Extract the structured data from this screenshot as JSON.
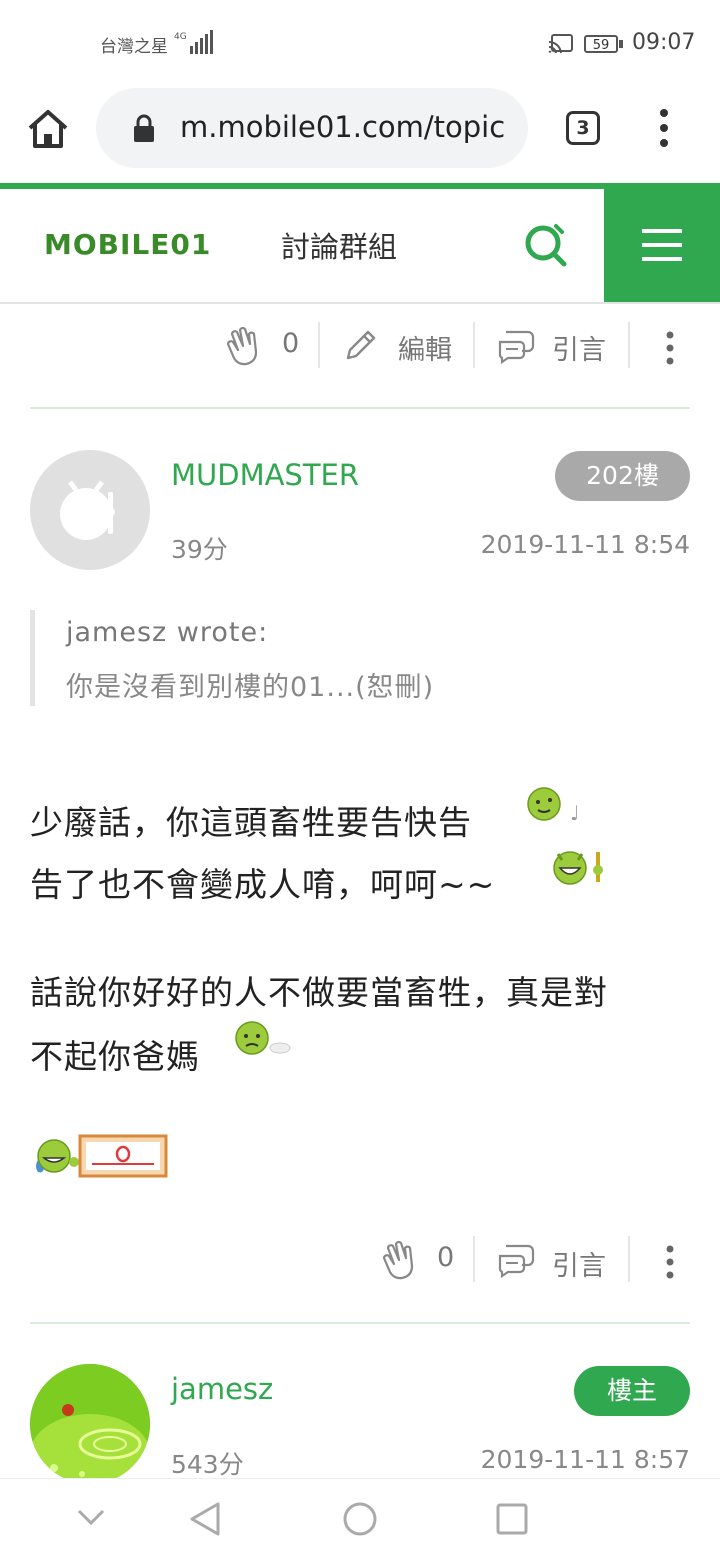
{
  "status_bar": {
    "carrier": "台灣之星",
    "network": "4G",
    "battery": "59",
    "time": "09:07"
  },
  "browser": {
    "url": "m.mobile01.com/topic",
    "tab_count": "3"
  },
  "site": {
    "logo_text": "MOBILE01",
    "section_title": "討論群組"
  },
  "top_actions": {
    "clap_count": "0",
    "edit_label": "編輯",
    "quote_label": "引言"
  },
  "post_202": {
    "username": "MUDMASTER",
    "floor": "202樓",
    "score": "39分",
    "datetime": "2019-11-11 8:54",
    "quote": {
      "author": "jamesz wrote:",
      "text": "你是沒看到別樓的01...(恕刪)"
    },
    "body": [
      "少廢話，你這頭畜牲要告快告",
      "告了也不會變成人唷，呵呵~~",
      "話說你好好的人不做要當畜牲，真是對",
      "不起你爸媽"
    ],
    "clap_count": "0",
    "quote_label": "引言"
  },
  "post_next": {
    "username": "jamesz",
    "badge": "樓主",
    "score": "543分",
    "datetime": "2019-11-11 8:57"
  },
  "icons": [
    "home-icon",
    "lock-icon",
    "more-vert-icon",
    "search-icon",
    "hamburger-icon",
    "clap-icon",
    "pencil-icon",
    "quote-bubble-icon",
    "back-icon",
    "home-circle-icon",
    "recents-icon",
    "collapse-icon"
  ],
  "colors": {
    "brand_green": "#2fa84f",
    "badge_gray": "#a9a9a9",
    "link_green": "#2fa84f"
  }
}
